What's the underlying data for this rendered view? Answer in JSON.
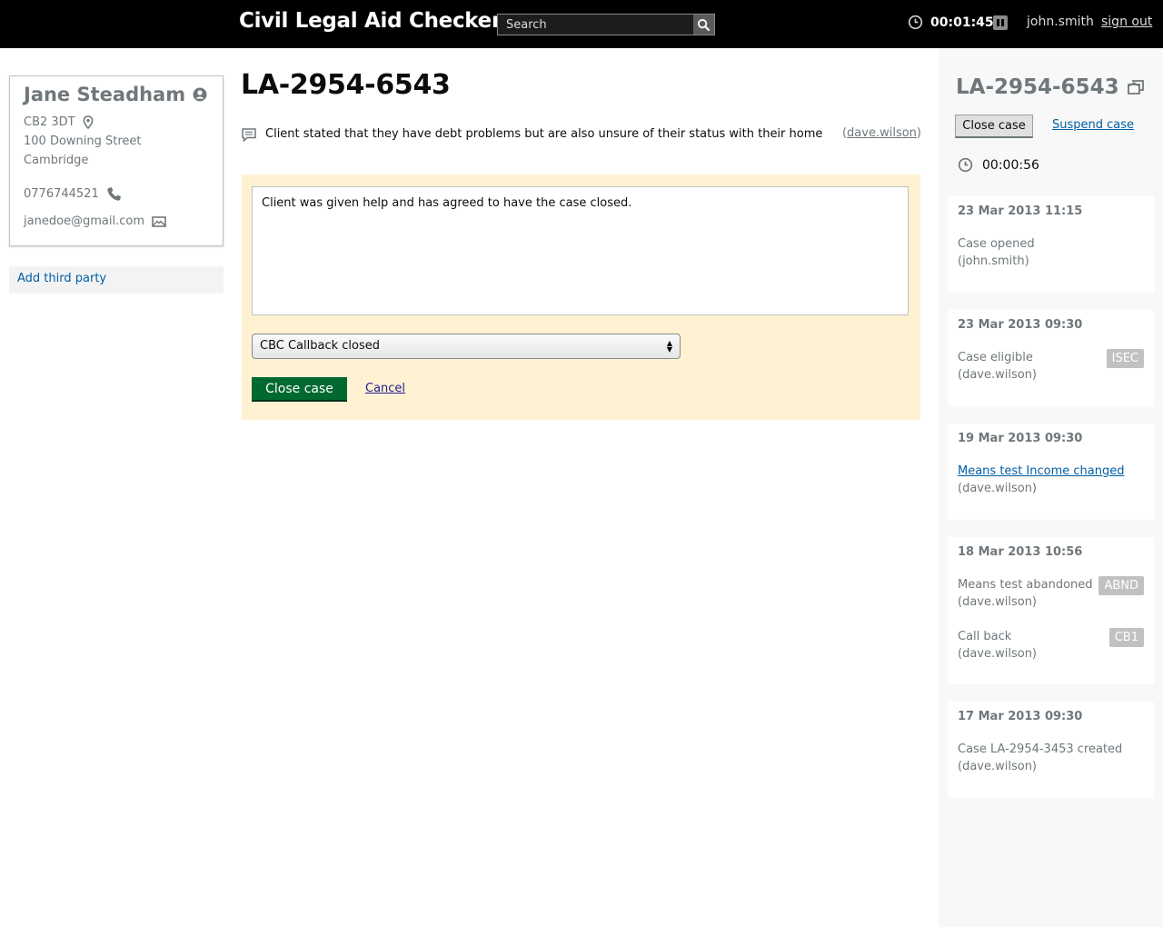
{
  "header": {
    "app_title": "Civil Legal Aid Checker",
    "search_placeholder": "Search",
    "timer": "00:01:45",
    "username": "john.smith",
    "signout_label": "sign out"
  },
  "client": {
    "name": "Jane Steadham",
    "postcode": "CB2 3DT",
    "address_line1": "100 Downing Street",
    "address_line2": "Cambridge",
    "phone": "0776744521",
    "email": "janedoe@gmail.com",
    "add_third_party_label": "Add third party"
  },
  "case": {
    "reference": "LA-2954-6543",
    "note": "Client stated that they have debt problems but are also unsure of their status with their home",
    "note_author": "dave.wilson",
    "close_form": {
      "notes_value": "Client was given help and has agreed to have the case closed.",
      "outcome_selected": "CBC Callback closed",
      "close_label": "Close case",
      "cancel_label": "Cancel"
    }
  },
  "sidebar": {
    "reference": "LA-2954-6543",
    "close_label": "Close case",
    "suspend_label": "Suspend case",
    "timer": "00:00:56",
    "events": [
      {
        "date": "23 Mar 2013 11:15",
        "items": [
          {
            "text": "Case opened",
            "user": "(john.smith)",
            "badge": ""
          }
        ]
      },
      {
        "date": "23 Mar 2013 09:30",
        "items": [
          {
            "text": "Case eligible",
            "user": "(dave.wilson)",
            "badge": "ISEC"
          }
        ]
      },
      {
        "date": "19 Mar 2013 09:30",
        "items": [
          {
            "text": "Means test Income changed",
            "user": "(dave.wilson)",
            "badge": ""
          }
        ]
      },
      {
        "date": "18 Mar 2013 10:56",
        "items": [
          {
            "text": "Means test abandoned",
            "user": "(dave.wilson)",
            "badge": "ABND"
          },
          {
            "text": "Call back",
            "user": "(dave.wilson)",
            "badge": "CB1"
          }
        ]
      },
      {
        "date": "17 Mar 2013 09:30",
        "items": [
          {
            "text": "Case LA-2954-3453 created",
            "user": "(dave.wilson)",
            "badge": ""
          }
        ]
      }
    ]
  },
  "icons": {
    "clock": "clock-icon",
    "pause": "pause-icon",
    "search": "search-icon",
    "user": "user-icon",
    "location": "location-pin-icon",
    "phone": "phone-icon",
    "email": "envelope-icon",
    "note": "speech-bubble-icon",
    "copy": "copy-icon"
  },
  "colors": {
    "header_bg": "#000000",
    "primary_button": "#00692f",
    "link": "#005ea5",
    "panel_bg": "#fff2d3",
    "muted_text": "#6f777b",
    "badge_bg": "#bfc1c3"
  }
}
